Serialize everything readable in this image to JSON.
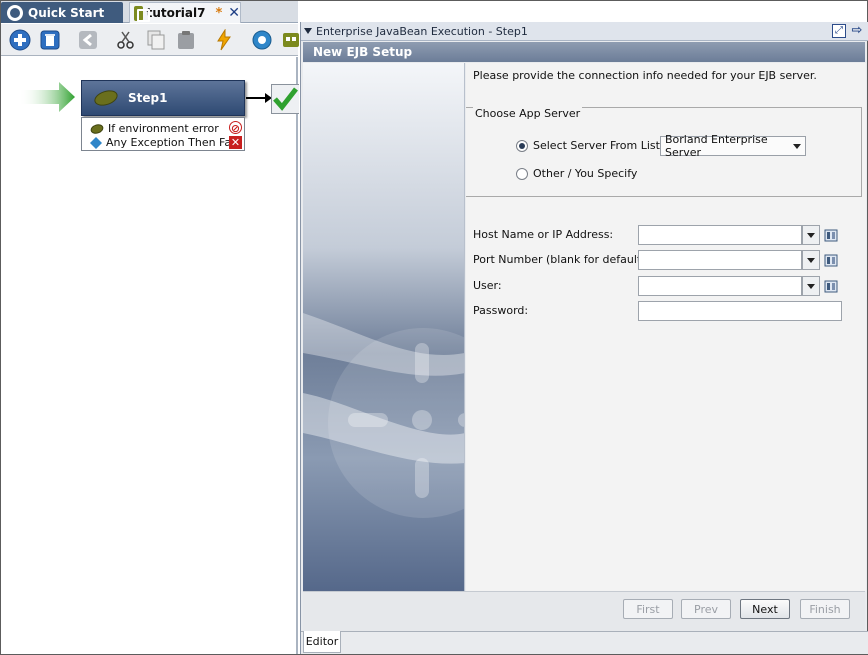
{
  "tabs": {
    "quick_start": "Quick Start",
    "tutorial": "tutorial7",
    "modified_mark": "*"
  },
  "workflow": {
    "step_label": "Step1",
    "conditions": [
      {
        "label": "If environment error",
        "icon": "no-entry-icon"
      },
      {
        "label": "Any Exception Then Fail",
        "icon": "red-x-icon"
      }
    ]
  },
  "editor": {
    "pane_title": "Enterprise JavaBean Execution - Step1",
    "header": "New EJB Setup",
    "intro": "Please provide the connection info needed for your EJB server.",
    "group_title": "Choose App Server",
    "radio_select": "Select Server From List:",
    "radio_other": "Other / You Specify",
    "selected_server": "Borland Enterprise Server",
    "fields": {
      "host": {
        "label": "Host Name or IP Address:",
        "value": ""
      },
      "port": {
        "label": "Port Number (blank for default):",
        "value": ""
      },
      "user": {
        "label": "User:",
        "value": ""
      },
      "password": {
        "label": "Password:",
        "value": ""
      }
    },
    "buttons": {
      "first": "First",
      "prev": "Prev",
      "next": "Next",
      "finish": "Finish"
    },
    "bottom_tab": "Editor"
  },
  "colors": {
    "accent_dark": "#3f5b7e",
    "step_bg": "#2f4a73",
    "success_green": "#2fa12f"
  }
}
